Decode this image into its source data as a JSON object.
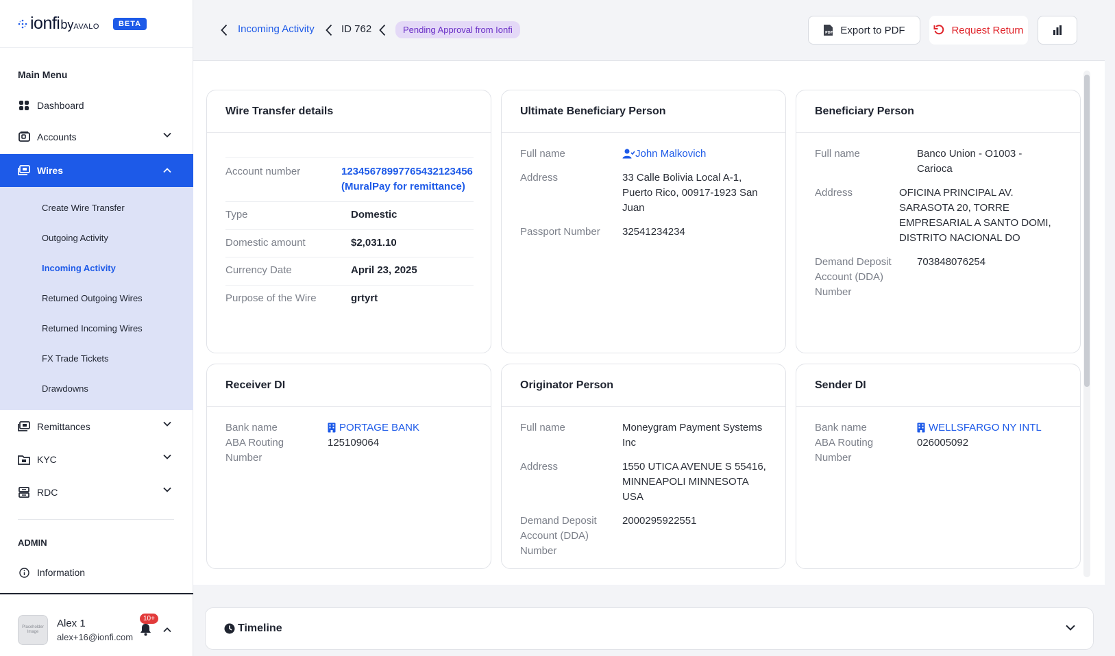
{
  "brand": {
    "name": "ionfi",
    "by": "by",
    "partner": "AVALO",
    "badge": "BETA"
  },
  "sidebar": {
    "menu_title": "Main Menu",
    "items": [
      {
        "label": "Dashboard",
        "icon": "grid-icon"
      },
      {
        "label": "Accounts",
        "icon": "wallet-icon"
      },
      {
        "label": "Wires",
        "icon": "wire-icon"
      },
      {
        "label": "Remittances",
        "icon": "remittance-icon"
      },
      {
        "label": "KYC",
        "icon": "folder-icon"
      },
      {
        "label": "RDC",
        "icon": "inbox-icon"
      }
    ],
    "wires_sub": [
      {
        "label": "Create Wire Transfer"
      },
      {
        "label": "Outgoing Activity"
      },
      {
        "label": "Incoming Activity"
      },
      {
        "label": "Returned Outgoing Wires"
      },
      {
        "label": "Returned Incoming Wires"
      },
      {
        "label": "FX Trade Tickets"
      },
      {
        "label": "Drawdowns"
      }
    ],
    "admin_title": "ADMIN",
    "admin_items": [
      {
        "label": "Information",
        "icon": "info-icon"
      }
    ],
    "user": {
      "avatar_text": "Placeholder Image",
      "name": "Alex 1",
      "email": "alex+16@ionfi.com",
      "notifications": "10+"
    }
  },
  "header": {
    "breadcrumb_link": "Incoming Activity",
    "breadcrumb_id": "ID 762",
    "status": "Pending Approval from Ionfi",
    "export_label": "Export to PDF",
    "return_label": "Request Return"
  },
  "cards": {
    "wire": {
      "title": "Wire Transfer details",
      "account_label": "Account number",
      "account_value": "12345678997765432123456",
      "account_note": "(MuralPay for remittance)",
      "type_label": "Type",
      "type_value": "Domestic",
      "amount_label": "Domestic amount",
      "amount_value": "$2,031.10",
      "date_label": "Currency Date",
      "date_value": "April 23, 2025",
      "purpose_label": "Purpose of the Wire",
      "purpose_value": "grtyrt"
    },
    "ultimate": {
      "title": "Ultimate Beneficiary Person",
      "name_label": "Full name",
      "name_value": "John Malkovich",
      "address_label": "Address",
      "address_1": "33 Calle Bolivia Local A-1,",
      "address_2": "Puerto Rico, 00917-1923 San",
      "address_3": "Juan",
      "passport_label": "Passport Number",
      "passport_value": "32541234234"
    },
    "beneficiary": {
      "title": "Beneficiary Person",
      "name_label": "Full name",
      "name_1": "Banco Union - O1003 -",
      "name_2": "Carioca",
      "address_label": "Address",
      "address_1": "OFICINA PRINCIPAL AV.",
      "address_2": "SARASOTA 20, TORRE",
      "address_3": "EMPRESARIAL A SANTO DOMI,",
      "address_4": "DISTRITO NACIONAL DO",
      "dda_label_1": "Demand Deposit",
      "dda_label_2": "Account (DDA)",
      "dda_label_3": "Number",
      "dda_value": "703848076254"
    },
    "receiver": {
      "title": "Receiver DI",
      "bank_label": "Bank name",
      "bank_value": "PORTAGE BANK",
      "aba_label_1": "ABA Routing",
      "aba_label_2": "Number",
      "aba_value": "125109064"
    },
    "originator": {
      "title": "Originator Person",
      "name_label": "Full name",
      "name_1": "Moneygram Payment Systems",
      "name_2": "Inc",
      "address_label": "Address",
      "address_1": "1550 UTICA AVENUE S 55416,",
      "address_2": "MINNEAPOLI MINNESOTA",
      "address_3": "USA",
      "dda_label_1": "Demand Deposit",
      "dda_label_2": "Account (DDA)",
      "dda_label_3": "Number",
      "dda_value": "2000295922551"
    },
    "sender": {
      "title": "Sender DI",
      "bank_label": "Bank name",
      "bank_value": "WELLSFARGO NY INTL",
      "aba_label_1": "ABA Routing",
      "aba_label_2": "Number",
      "aba_value": "026005092"
    }
  },
  "timeline": {
    "title": "Timeline"
  },
  "colors": {
    "accent": "#1d5ae8",
    "danger": "#e0252b",
    "pill_bg": "#e4d9f7",
    "pill_text": "#6a2fc6",
    "submenu_bg": "#dde2f7"
  }
}
